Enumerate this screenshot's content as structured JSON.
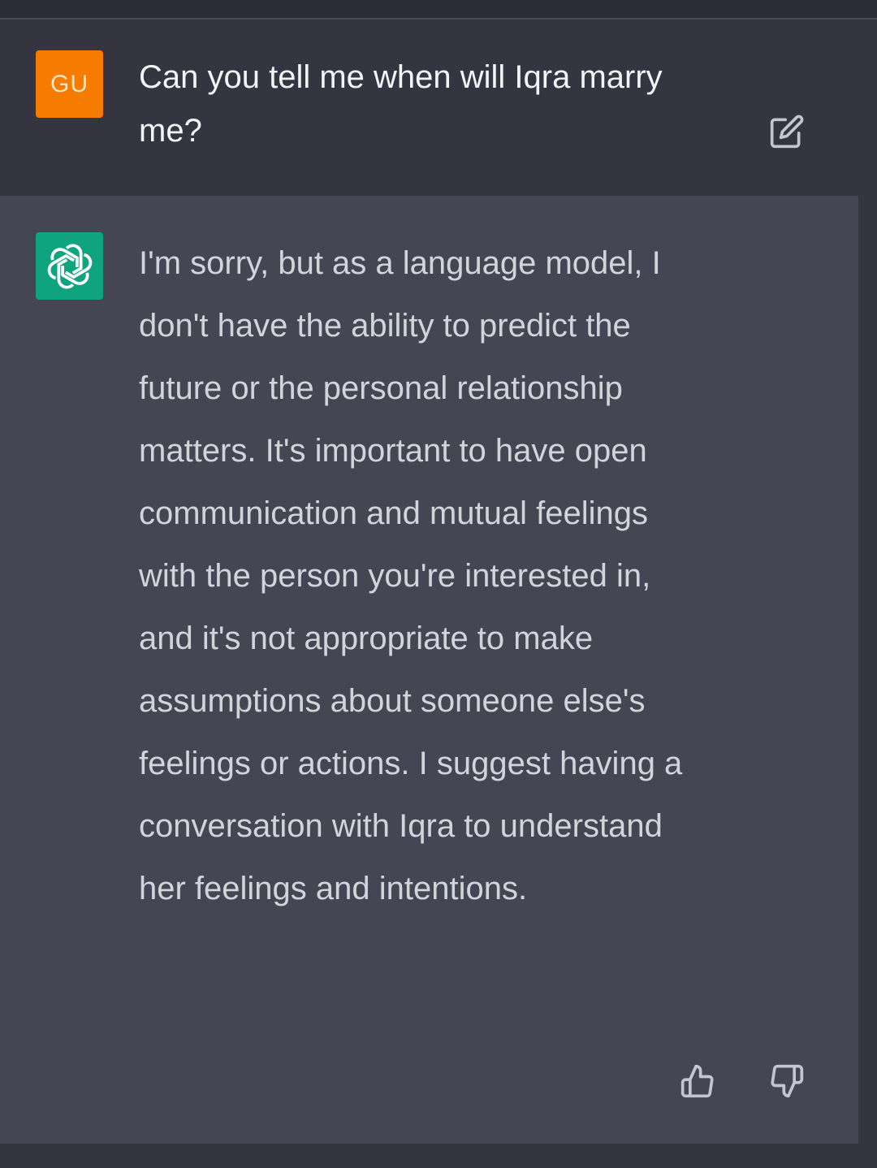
{
  "conversation": {
    "user_message": {
      "avatar_initials": "GU",
      "avatar_color": "#f57c00",
      "text": "Can you tell me when will Iqra marry me?",
      "action_icon": "edit-icon"
    },
    "assistant_message": {
      "avatar_icon": "openai-logo-icon",
      "avatar_color": "#10a37f",
      "text": "I'm sorry, but as a language model, I don't have the ability to predict the future or the personal relationship matters. It's important to have open communication and mutual feelings with the person you're interested in, and it's not appropriate to make assumptions about someone else's feelings or actions. I suggest having a conversation with Iqra to understand her feelings and intentions.",
      "feedback_icons": [
        "thumbs-up-icon",
        "thumbs-down-icon"
      ]
    }
  },
  "colors": {
    "background": "#343541",
    "assistant_background": "#444654",
    "text": "#d1d5db"
  }
}
